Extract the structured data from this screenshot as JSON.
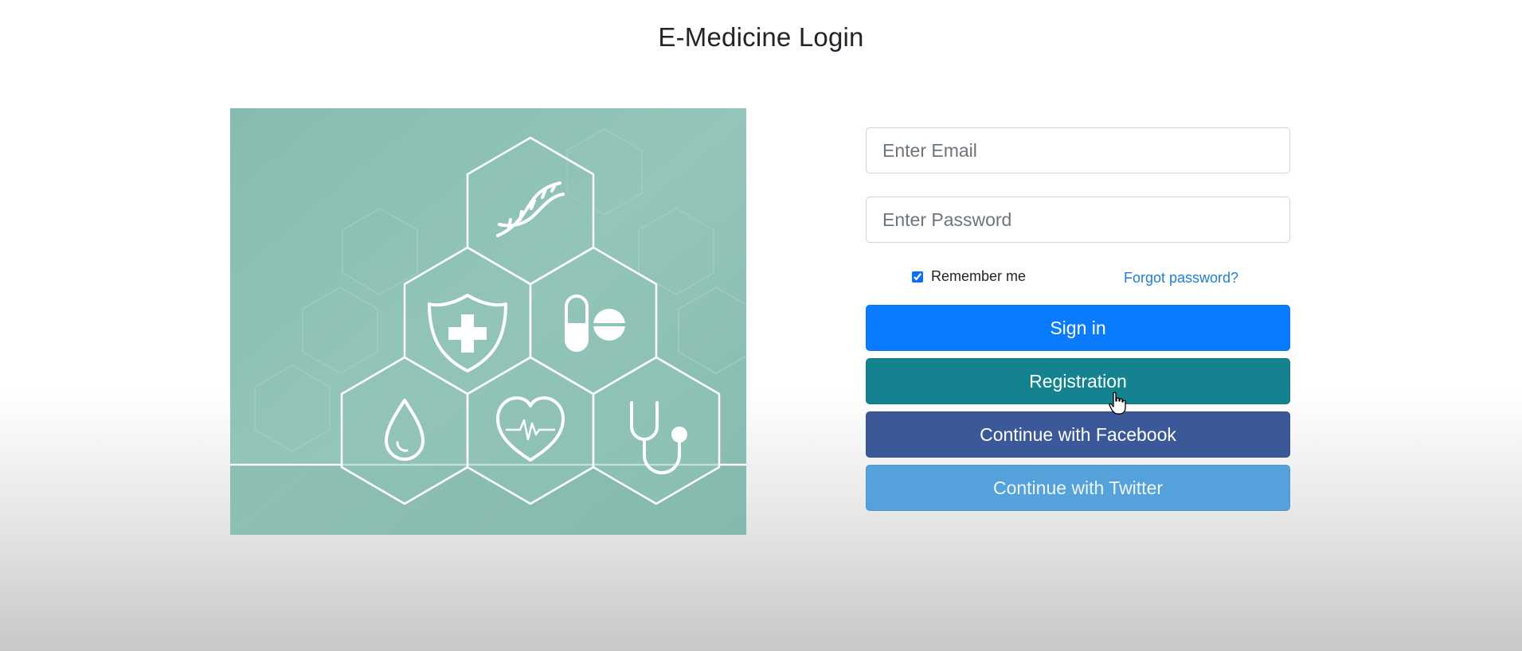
{
  "page": {
    "title": "E-Medicine Login"
  },
  "form": {
    "email": {
      "placeholder": "Enter Email",
      "value": ""
    },
    "password": {
      "placeholder": "Enter Password",
      "value": ""
    },
    "remember": {
      "label": "Remember me",
      "checked": true
    },
    "forgot_label": "Forgot password?"
  },
  "buttons": {
    "signin": "Sign in",
    "registration": "Registration",
    "facebook": "Continue with Facebook",
    "twitter": "Continue with Twitter"
  },
  "hero": {
    "icons": [
      "dna-icon",
      "shield-plus-icon",
      "pills-icon",
      "blood-drop-icon",
      "heartbeat-icon",
      "stethoscope-icon"
    ]
  },
  "colors": {
    "signin": "#0a7bff",
    "registration": "#15838f",
    "facebook": "#3b5998",
    "twitter": "#55a1db",
    "hero_bg": "#8ebfb5",
    "link": "#1e7ed6"
  }
}
